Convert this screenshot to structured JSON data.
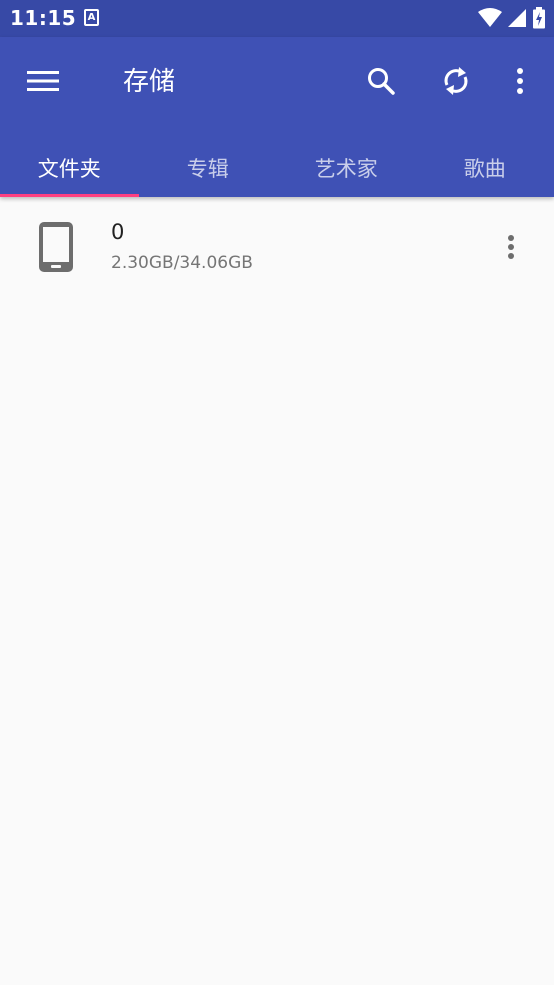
{
  "status_bar": {
    "time": "11:15",
    "notification_icon_label": "A",
    "icons": [
      "wifi-icon",
      "signal-icon",
      "battery-charging-icon"
    ]
  },
  "toolbar": {
    "title": "存储",
    "menu_icon": "hamburger-menu-icon",
    "search_icon": "search-icon",
    "refresh_icon": "refresh-icon",
    "overflow_icon": "more-vert-icon"
  },
  "tabs": [
    {
      "label": "文件夹",
      "active": true
    },
    {
      "label": "专辑",
      "active": false
    },
    {
      "label": "艺术家",
      "active": false
    },
    {
      "label": "歌曲",
      "active": false
    }
  ],
  "storage_list": [
    {
      "title": "0",
      "subtitle": "2.30GB/34.06GB",
      "icon": "phone-icon",
      "menu_icon": "more-vert-icon"
    }
  ],
  "colors": {
    "status_bar": "#3749a6",
    "app_bar": "#3f51b5",
    "tab_indicator": "#ff4081",
    "background": "#fafafa",
    "icon_gray": "#6d6d6d"
  }
}
